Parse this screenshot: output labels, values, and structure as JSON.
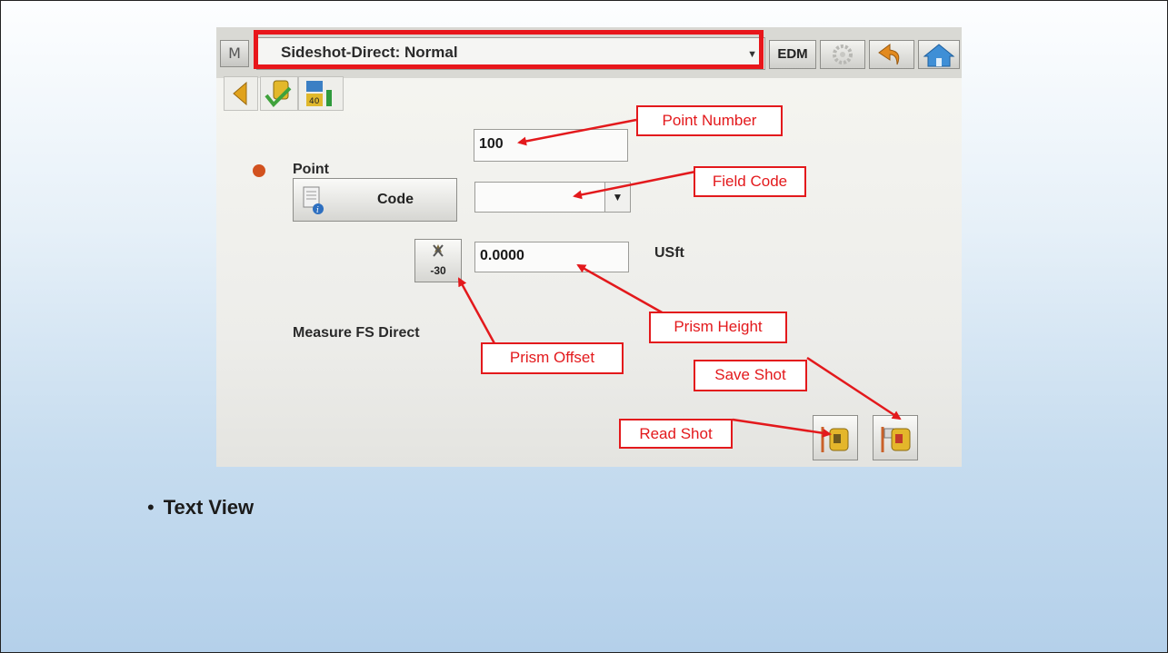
{
  "screen": {
    "menu_button": "M",
    "mode_select": "Sideshot-Direct: Normal",
    "edm_button": "EDM",
    "point_label": "Point",
    "point_value": "100",
    "code_button": "Code",
    "code_value": "",
    "prism_offset_value": "-30",
    "prism_height_value": "0.0000",
    "units": "USft",
    "measure_label": "Measure FS Direct"
  },
  "annotations": {
    "point_number": "Point Number",
    "field_code": "Field Code",
    "prism_height": "Prism Height",
    "prism_offset": "Prism Offset",
    "save_shot": "Save Shot",
    "read_shot": "Read Shot"
  },
  "slide": {
    "bullet_text": "Text View"
  },
  "colors": {
    "annotation_red": "#e3191c",
    "status_dot": "#d2521f"
  }
}
